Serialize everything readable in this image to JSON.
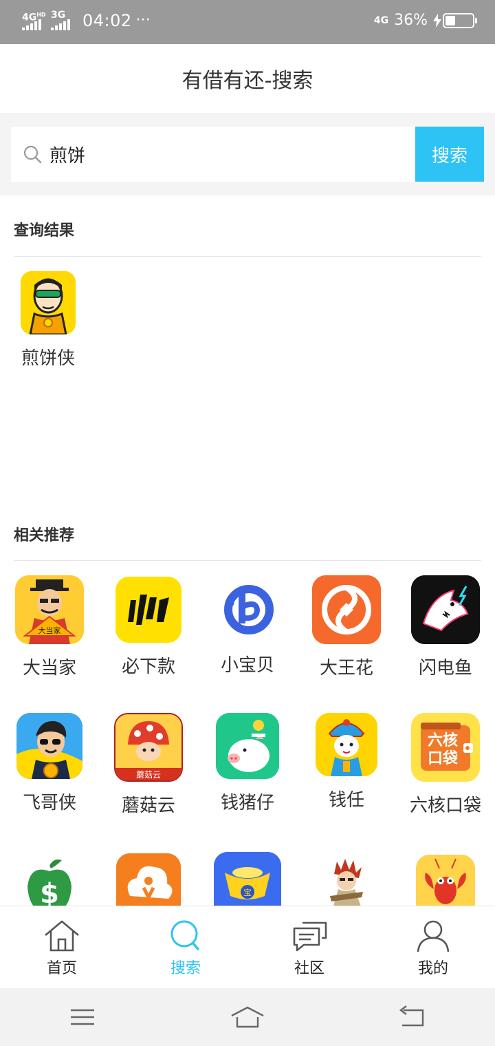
{
  "status_bar": {
    "network1": "4G",
    "network1_sup": "HD",
    "network2": "3G",
    "time": "04:02",
    "dots": "···",
    "network3": "4G",
    "battery_percent": "36%",
    "battery_level": 0.36
  },
  "header": {
    "title": "有借有还-搜索"
  },
  "search": {
    "value": "煎饼",
    "placeholder": "",
    "button_label": "搜索"
  },
  "results": {
    "title": "查询结果",
    "items": [
      {
        "name": "煎饼侠",
        "icon": "pancake-hero-app-icon"
      }
    ]
  },
  "recommend": {
    "title": "相关推荐",
    "rows": [
      [
        {
          "name": "大当家",
          "icon": "dadangjia-app-icon"
        },
        {
          "name": "必下款",
          "icon": "bixiakuan-app-icon"
        },
        {
          "name": "小宝贝",
          "icon": "xiaobaobei-app-icon"
        },
        {
          "name": "大王花",
          "icon": "dawanghua-app-icon"
        },
        {
          "name": "闪电鱼",
          "icon": "shandianyu-app-icon"
        }
      ],
      [
        {
          "name": "飞哥侠",
          "icon": "feigexia-app-icon"
        },
        {
          "name": "蘑菇云",
          "icon": "moguyun-app-icon"
        },
        {
          "name": "钱猪仔",
          "icon": "qianzhuzai-app-icon"
        },
        {
          "name": "钱任",
          "icon": "qianren-app-icon"
        },
        {
          "name": "六核口袋",
          "icon": "liuhekoudai-app-icon"
        }
      ],
      [
        {
          "icon": "dollar-apple-app-icon"
        },
        {
          "icon": "orange-cloud-app-icon"
        },
        {
          "icon": "gold-ingot-app-icon"
        },
        {
          "icon": "ninja-app-icon"
        },
        {
          "icon": "lobster-app-icon"
        }
      ]
    ],
    "moguyun_badge": "蘑菇云",
    "dadangjia_fan": "大当家",
    "liuhe_icon_text": "六核口袋",
    "ingot_text": "宝"
  },
  "bottom_nav": {
    "items": [
      {
        "label": "首页",
        "icon": "home-icon"
      },
      {
        "label": "搜索",
        "icon": "search-icon",
        "active": true
      },
      {
        "label": "社区",
        "icon": "chat-icon"
      },
      {
        "label": "我的",
        "icon": "user-icon"
      }
    ]
  },
  "colors": {
    "accent": "#2ec3f5",
    "status_bar": "#9a9a9a",
    "search_bg": "#f4f4f4"
  }
}
